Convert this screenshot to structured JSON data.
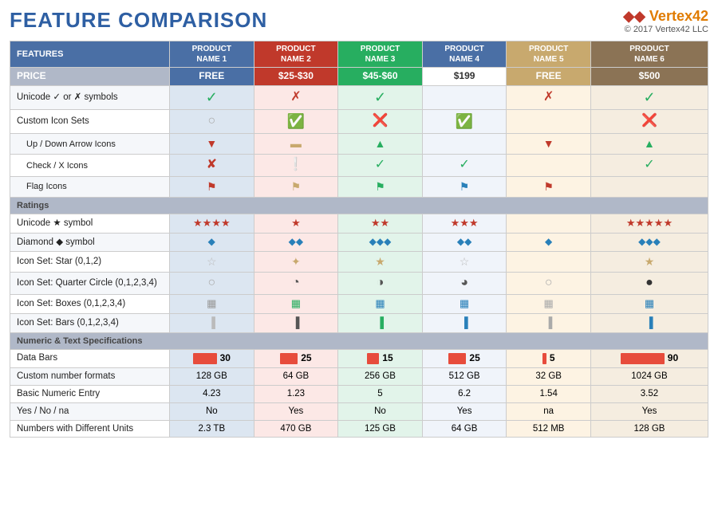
{
  "title": "FEATURE COMPARISON",
  "logo": {
    "brand": "Vertex42",
    "copyright": "© 2017 Vertex42 LLC"
  },
  "columns": {
    "features": "FEATURES",
    "p1": "PRODUCT\nNAME 1",
    "p2": "PRODUCT\nNAME 2",
    "p3": "PRODUCT\nNAME 3",
    "p4": "PRODUCT\nNAME 4",
    "p5": "PRODUCT\nNAME 5",
    "p6": "PRODUCT\nNAME 6"
  },
  "prices": {
    "label": "PRICE",
    "p1": "FREE",
    "p2": "$25-$30",
    "p3": "$45-$60",
    "p4": "$199",
    "p5": "FREE",
    "p6": "$500"
  },
  "sections": {
    "customIconSets": "Custom Icon Sets",
    "ratings": "Ratings",
    "numericText": "Numeric & Text Specifications"
  }
}
